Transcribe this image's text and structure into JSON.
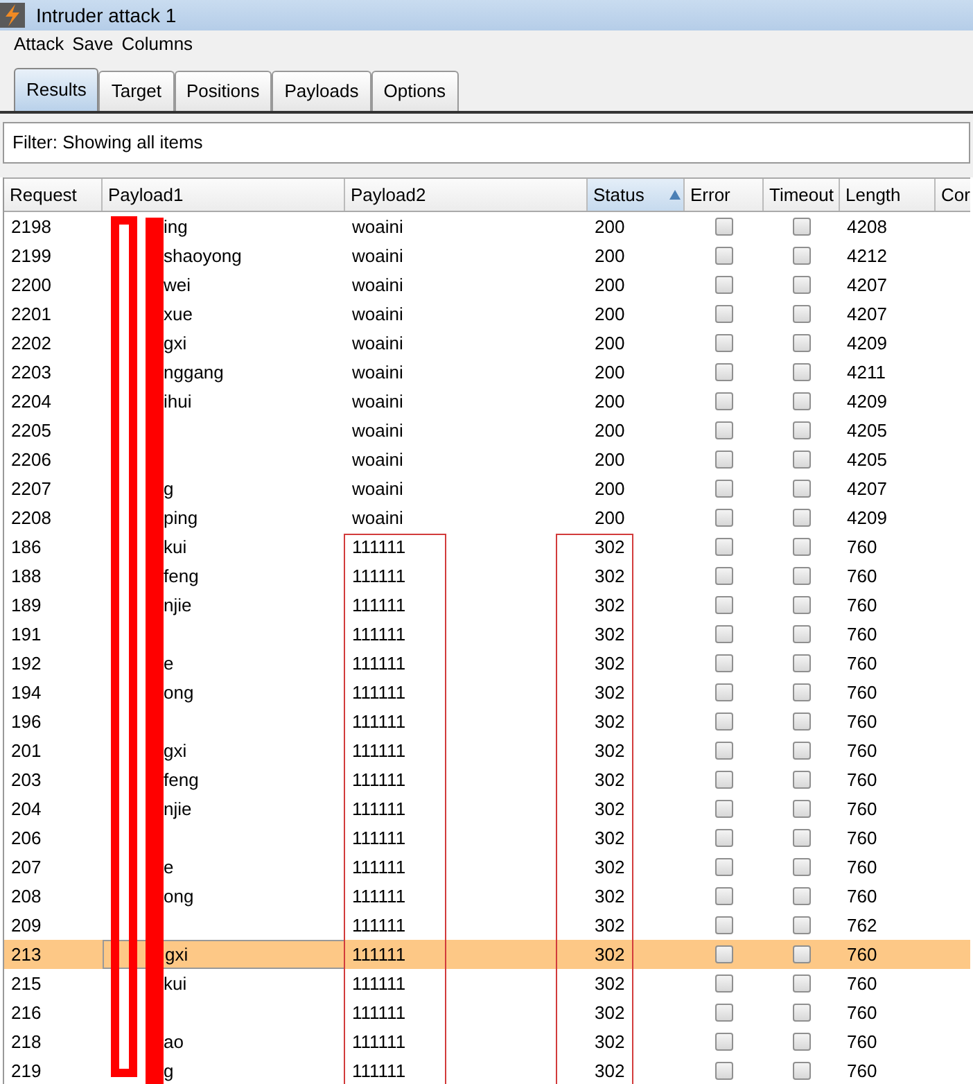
{
  "window": {
    "title": "Intruder attack 1"
  },
  "menu": [
    "Attack",
    "Save",
    "Columns"
  ],
  "tabs": [
    {
      "label": "Results",
      "selected": true
    },
    {
      "label": "Target",
      "selected": false
    },
    {
      "label": "Positions",
      "selected": false
    },
    {
      "label": "Payloads",
      "selected": false
    },
    {
      "label": "Options",
      "selected": false
    }
  ],
  "filter": "Filter: Showing all items",
  "table": {
    "columns": [
      {
        "label": "Request",
        "sorted": false
      },
      {
        "label": "Payload1",
        "sorted": false
      },
      {
        "label": "Payload2",
        "sorted": false
      },
      {
        "label": "Status",
        "sorted": true
      },
      {
        "label": "Error",
        "sorted": false
      },
      {
        "label": "Timeout",
        "sorted": false
      },
      {
        "label": "Length",
        "sorted": false
      },
      {
        "label": "Cor",
        "sorted": false
      }
    ],
    "rows": [
      {
        "request": "2198",
        "payload1": "ing",
        "payload2": "woaini",
        "status": "200",
        "error": false,
        "timeout": false,
        "length": "4208",
        "selected": false
      },
      {
        "request": "2199",
        "payload1": "shaoyong",
        "payload2": "woaini",
        "status": "200",
        "error": false,
        "timeout": false,
        "length": "4212",
        "selected": false
      },
      {
        "request": "2200",
        "payload1": "wei",
        "payload2": "woaini",
        "status": "200",
        "error": false,
        "timeout": false,
        "length": "4207",
        "selected": false
      },
      {
        "request": "2201",
        "payload1": "xue",
        "payload2": "woaini",
        "status": "200",
        "error": false,
        "timeout": false,
        "length": "4207",
        "selected": false
      },
      {
        "request": "2202",
        "payload1": "gxi",
        "payload2": "woaini",
        "status": "200",
        "error": false,
        "timeout": false,
        "length": "4209",
        "selected": false
      },
      {
        "request": "2203",
        "payload1": "nggang",
        "payload2": "woaini",
        "status": "200",
        "error": false,
        "timeout": false,
        "length": "4211",
        "selected": false
      },
      {
        "request": "2204",
        "payload1": "ihui",
        "payload2": "woaini",
        "status": "200",
        "error": false,
        "timeout": false,
        "length": "4209",
        "selected": false
      },
      {
        "request": "2205",
        "payload2": "woaini",
        "status": "200",
        "error": false,
        "timeout": false,
        "length": "4205",
        "selected": false
      },
      {
        "request": "2206",
        "payload2": "woaini",
        "status": "200",
        "error": false,
        "timeout": false,
        "length": "4205",
        "selected": false
      },
      {
        "request": "2207",
        "payload1": "g",
        "payload2": "woaini",
        "status": "200",
        "error": false,
        "timeout": false,
        "length": "4207",
        "selected": false
      },
      {
        "request": "2208",
        "payload1": "ping",
        "payload2": "woaini",
        "status": "200",
        "error": false,
        "timeout": false,
        "length": "4209",
        "selected": false
      },
      {
        "request": "186",
        "payload1": "kui",
        "payload2": "111111",
        "status": "302",
        "error": false,
        "timeout": false,
        "length": "760",
        "selected": false
      },
      {
        "request": "188",
        "payload1": "feng",
        "payload2": "111111",
        "status": "302",
        "error": false,
        "timeout": false,
        "length": "760",
        "selected": false
      },
      {
        "request": "189",
        "payload1": "njie",
        "payload2": "111111",
        "status": "302",
        "error": false,
        "timeout": false,
        "length": "760",
        "selected": false
      },
      {
        "request": "191",
        "payload2": "111111",
        "status": "302",
        "error": false,
        "timeout": false,
        "length": "760",
        "selected": false
      },
      {
        "request": "192",
        "payload1": "e",
        "payload2": "111111",
        "status": "302",
        "error": false,
        "timeout": false,
        "length": "760",
        "selected": false
      },
      {
        "request": "194",
        "payload1": "ong",
        "payload2": "111111",
        "status": "302",
        "error": false,
        "timeout": false,
        "length": "760",
        "selected": false
      },
      {
        "request": "196",
        "payload2": "111111",
        "status": "302",
        "error": false,
        "timeout": false,
        "length": "760",
        "selected": false
      },
      {
        "request": "201",
        "payload1": "gxi",
        "payload2": "111111",
        "status": "302",
        "error": false,
        "timeout": false,
        "length": "760",
        "selected": false
      },
      {
        "request": "203",
        "payload1": "feng",
        "payload2": "111111",
        "status": "302",
        "error": false,
        "timeout": false,
        "length": "760",
        "selected": false
      },
      {
        "request": "204",
        "payload1": "njie",
        "payload2": "111111",
        "status": "302",
        "error": false,
        "timeout": false,
        "length": "760",
        "selected": false
      },
      {
        "request": "206",
        "payload2": "111111",
        "status": "302",
        "error": false,
        "timeout": false,
        "length": "760",
        "selected": false
      },
      {
        "request": "207",
        "payload1": "e",
        "payload2": "111111",
        "status": "302",
        "error": false,
        "timeout": false,
        "length": "760",
        "selected": false
      },
      {
        "request": "208",
        "payload1": "ong",
        "payload2": "111111",
        "status": "302",
        "error": false,
        "timeout": false,
        "length": "760",
        "selected": false
      },
      {
        "request": "209",
        "payload2": "111111",
        "status": "302",
        "error": false,
        "timeout": false,
        "length": "762",
        "selected": false
      },
      {
        "request": "213",
        "payload1": "gxi",
        "payload2": "111111",
        "status": "302",
        "error": false,
        "timeout": false,
        "length": "760",
        "selected": true
      },
      {
        "request": "215",
        "payload1": "kui",
        "payload2": "111111",
        "status": "302",
        "error": false,
        "timeout": false,
        "length": "760",
        "selected": false
      },
      {
        "request": "216",
        "payload2": "111111",
        "status": "302",
        "error": false,
        "timeout": false,
        "length": "760",
        "selected": false
      },
      {
        "request": "218",
        "payload1": "ao",
        "payload2": "111111",
        "status": "302",
        "error": false,
        "timeout": false,
        "length": "760",
        "selected": false
      },
      {
        "request": "219",
        "payload1": "g",
        "payload2": "111111",
        "status": "302",
        "error": false,
        "timeout": false,
        "length": "760",
        "selected": false
      }
    ]
  }
}
